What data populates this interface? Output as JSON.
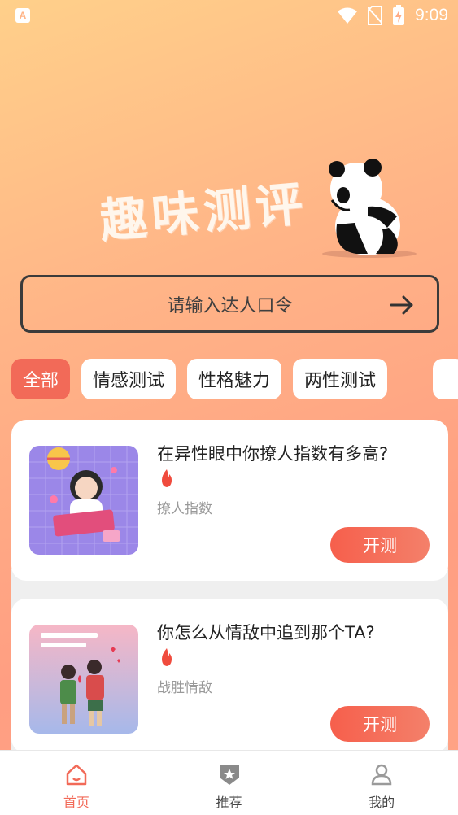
{
  "status_bar": {
    "time": "9:09",
    "app_badge": "A"
  },
  "hero": {
    "title": "趣味测评"
  },
  "search": {
    "placeholder": "请输入达人口令"
  },
  "tabs": [
    {
      "label": "全部",
      "active": true
    },
    {
      "label": "情感测试",
      "active": false
    },
    {
      "label": "性格魅力",
      "active": false
    },
    {
      "label": "两性测试",
      "active": false
    }
  ],
  "cards": [
    {
      "title": "在异性眼中你撩人指数有多高?",
      "subtitle": "撩人指数",
      "button": "开测",
      "icon": "fire-icon"
    },
    {
      "title": "你怎么从情敌中追到那个TA?",
      "subtitle": "战胜情敌",
      "button": "开测",
      "icon": "fire-icon"
    }
  ],
  "bottom_nav": [
    {
      "label": "首页",
      "icon": "home-icon",
      "active": true
    },
    {
      "label": "推荐",
      "icon": "recommend-icon",
      "active": false
    },
    {
      "label": "我的",
      "icon": "user-icon",
      "active": false
    }
  ],
  "colors": {
    "accent": "#f26a58",
    "button_gradient_start": "#f65f4c",
    "button_gradient_end": "#f4806a"
  }
}
